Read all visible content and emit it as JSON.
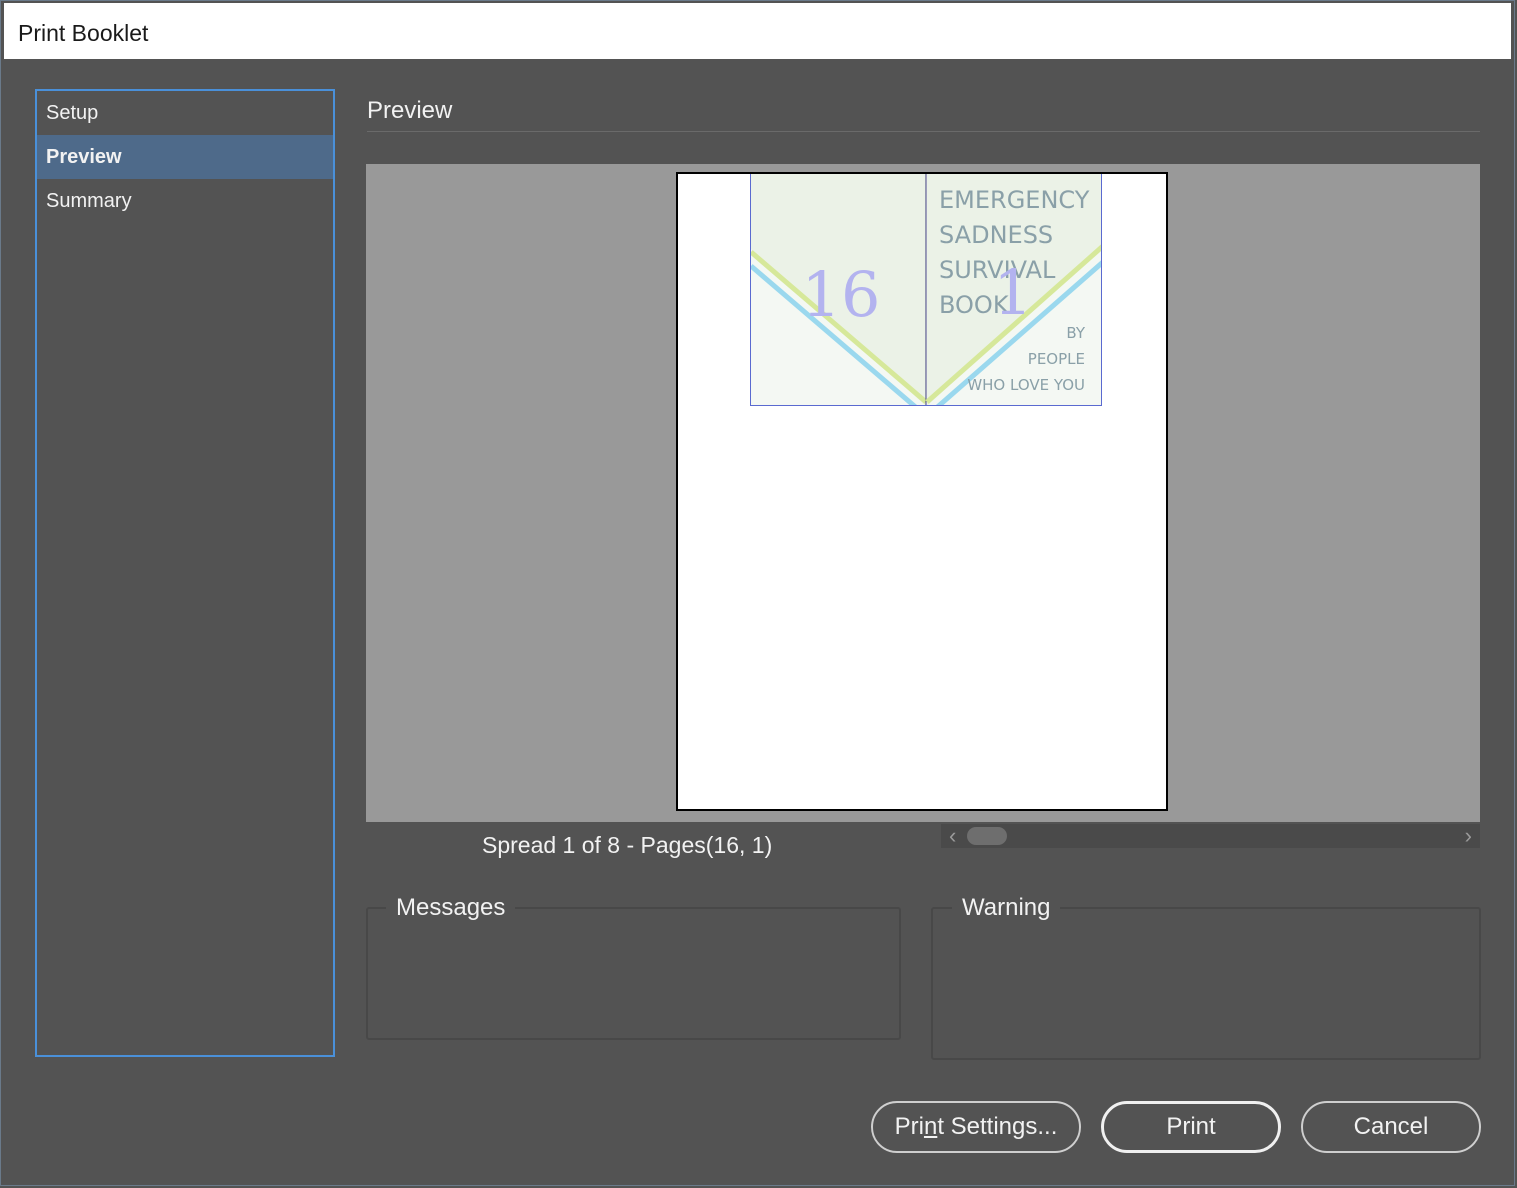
{
  "window": {
    "title": "Print Booklet"
  },
  "sidebar": {
    "items": [
      {
        "label": "Setup",
        "active": false
      },
      {
        "label": "Preview",
        "active": true
      },
      {
        "label": "Summary",
        "active": false
      }
    ]
  },
  "main": {
    "section_title": "Preview",
    "spread_info": "Spread 1 of 8 - Pages(16, 1)",
    "preview": {
      "left_page_number": "16",
      "right_page_number": "1",
      "cover_title_lines": [
        "EMERGENCY",
        "SADNESS",
        "SURVIVAL",
        "BOOK"
      ],
      "cover_byline_lines": [
        "BY",
        "PEOPLE",
        "WHO LOVE YOU"
      ]
    },
    "scrollbar": {
      "left_arrow": "‹",
      "right_arrow": "›"
    },
    "messages_label": "Messages",
    "warning_label": "Warning"
  },
  "buttons": {
    "print_settings": {
      "before": "Pri",
      "mnemonic": "n",
      "after": "t Settings..."
    },
    "print": "Print",
    "cancel": "Cancel"
  },
  "colors": {
    "accent": "#4a90d9",
    "selected_item": "#4e6a8a",
    "page_number": "#b3b3ef",
    "cover_text": "#8aa0a8",
    "stripe_green": "#d6e89a",
    "stripe_blue": "#9ad8ee"
  }
}
